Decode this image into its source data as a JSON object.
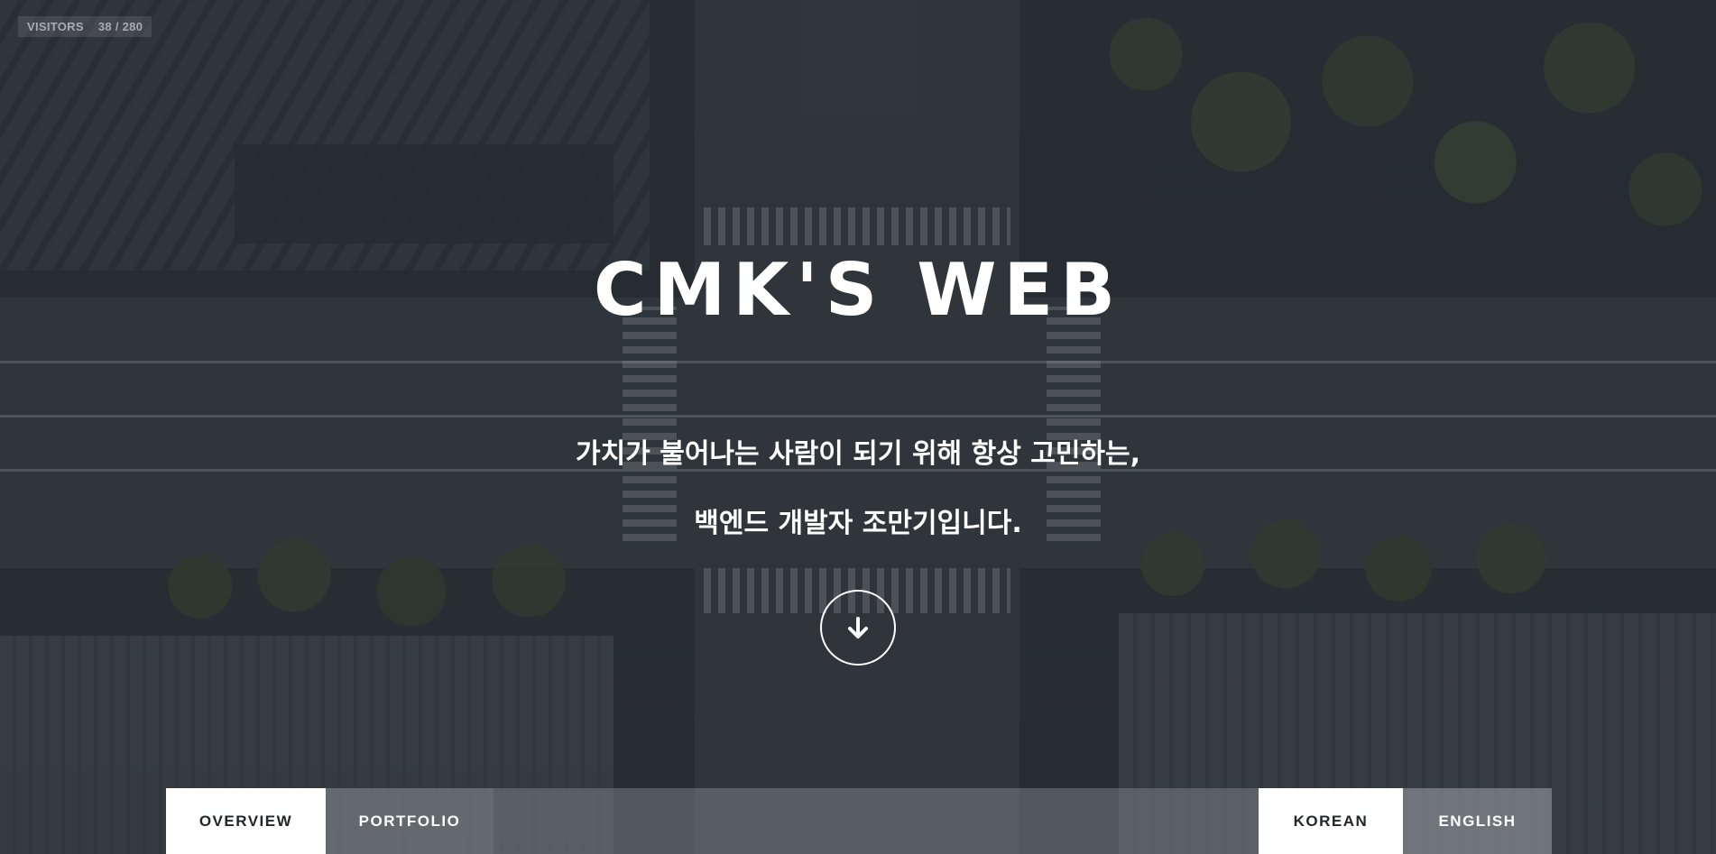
{
  "visitors": {
    "label": "VISITORS",
    "count": "38 / 280"
  },
  "hero": {
    "title": "CMK'S WEB",
    "line1": "가치가 불어나는 사람이 되기 위해 항상 고민하는,",
    "line2": "백엔드 개발자 조만기입니다.",
    "scroll_icon": "arrow-down-icon"
  },
  "nav": {
    "overview": "OVERVIEW",
    "portfolio": "PORTFOLIO",
    "korean": "KOREAN",
    "english": "ENGLISH"
  },
  "colors": {
    "text": "#ffffff",
    "active_bg": "#ffffff",
    "active_text": "#222629"
  }
}
